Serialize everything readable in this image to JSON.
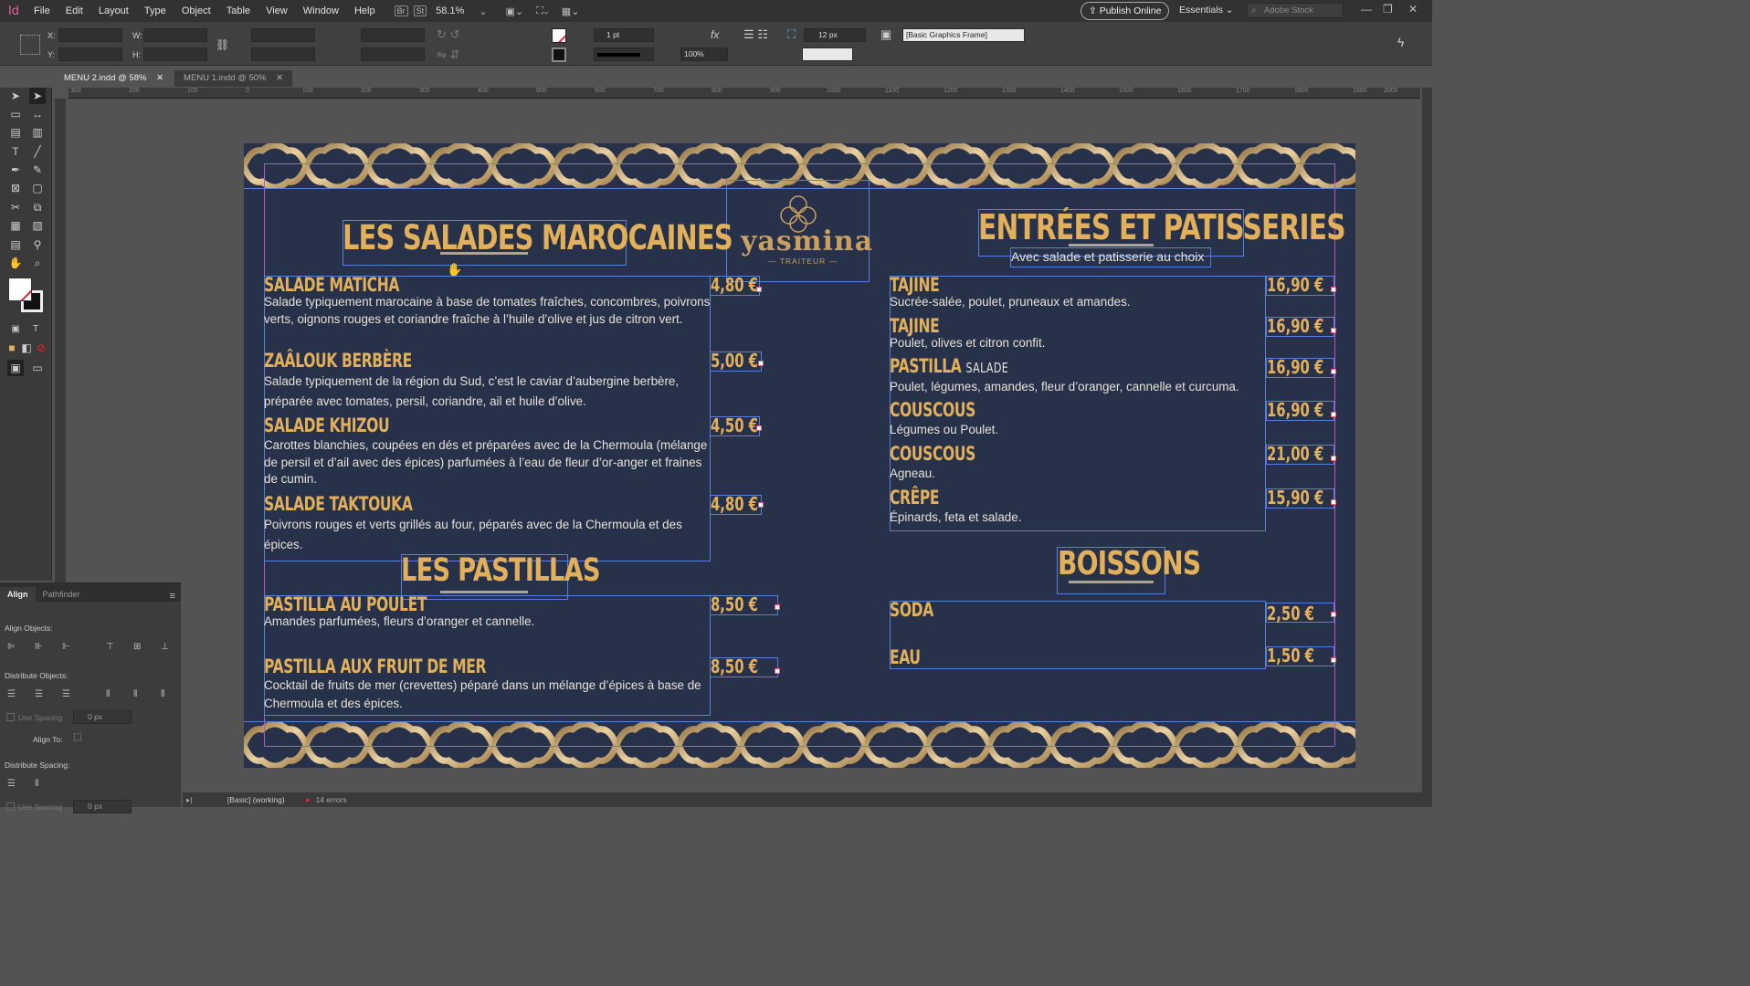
{
  "app": {
    "logo": "Id",
    "menu": [
      "File",
      "Edit",
      "Layout",
      "Type",
      "Object",
      "Table",
      "View",
      "Window",
      "Help"
    ],
    "bridge": "Br",
    "stock_btn": "St",
    "zoom": "58.1%",
    "publish": "Publish Online",
    "workspace": "Essentials",
    "search_placeholder": "Adobe Stock"
  },
  "control": {
    "x_label": "X:",
    "y_label": "Y:",
    "w_label": "W:",
    "h_label": "H:",
    "stroke_weight": "1 pt",
    "scale": "100%",
    "gap": "12 px",
    "frame_style": "[Basic Graphics Frame]"
  },
  "tabs": [
    {
      "label": "MENU 2.indd @ 58%"
    },
    {
      "label": "MENU 1.indd @ 50%"
    }
  ],
  "ruler": [
    "300",
    "200",
    "100",
    "0",
    "100",
    "200",
    "300",
    "400",
    "500",
    "600",
    "700",
    "800",
    "900",
    "1000",
    "1100",
    "1200",
    "1300",
    "1400",
    "1500",
    "1600",
    "1700",
    "1800",
    "1900",
    "2000"
  ],
  "align_panel": {
    "tab_align": "Align",
    "tab_pathfinder": "Pathfinder",
    "align_objects": "Align Objects:",
    "distribute_objects": "Distribute Objects:",
    "use_spacing": "Use Spacing",
    "spacing_value": "0 px",
    "align_to": "Align To:",
    "distribute_spacing": "Distribute Spacing:",
    "use_spacing_2": "Use Spacing",
    "spacing_value_2": "0 px"
  },
  "status": {
    "preflight_profile": "[Basic] (working)",
    "errors": "14 errors"
  },
  "menu_doc": {
    "brand": "yasmina",
    "brand_sub": "TRAITEUR",
    "left": {
      "title": "LES SALADES MAROCAINES",
      "items": [
        {
          "name": "SALADE MATICHA",
          "price": "4,80 €",
          "desc": "Salade typiquement marocaine à base de tomates fraîches, concombres, poivrons verts, oignons rouges et coriandre fraîche à l’huile d’olive et jus de citron vert."
        },
        {
          "name": "ZAÂLOUK BERBÈRE",
          "price": "5,00 €",
          "desc": "Salade typiquement de la région du Sud, c’est le caviar d’aubergine berbère, préparée avec tomates, persil, coriandre, ail et huile d’olive."
        },
        {
          "name": "SALADE KHIZOU",
          "price": "4,50 €",
          "desc": "Carottes blanchies, coupées en dés et préparées avec de la Chermoula (mélange de persil et d’ail avec des épices) parfumées à l’eau de fleur d’or-anger et fraines de cumin."
        },
        {
          "name": "SALADE TAKTOUKA",
          "price": "4,80 €",
          "desc": "Poivrons rouges et verts grillés au four, péparés avec de la Chermoula et des épices."
        }
      ]
    },
    "pastillas": {
      "title": "LES PASTILLAS",
      "items": [
        {
          "name": "PASTILLA AU POULET",
          "price": "8,50 €",
          "desc": "Amandes parfumées, fleurs d’oranger et cannelle."
        },
        {
          "name": "PASTILLA AUX FRUIT DE MER",
          "price": "8,50 €",
          "desc": "Cocktail de fruits de mer (crevettes) péparé dans un mélange d’épices à base de Chermoula et des épices."
        }
      ]
    },
    "right": {
      "title": "ENTRÉES ET PATISSERIES",
      "subtitle": "Avec salade et patisserie au choix",
      "items": [
        {
          "name": "TAJINE",
          "extra": "",
          "price": "16,90 €",
          "desc": "Sucrée-salée, poulet, pruneaux et amandes."
        },
        {
          "name": "TAJINE",
          "extra": "",
          "price": "16,90 €",
          "desc": "Poulet, olives et citron confit."
        },
        {
          "name": "PASTILLA",
          "extra": "SALADE",
          "price": "16,90 €",
          "desc": "Poulet, légumes, amandes, fleur d’oranger, cannelle et curcuma."
        },
        {
          "name": "COUSCOUS",
          "extra": "",
          "price": "16,90 €",
          "desc": "Légumes ou Poulet."
        },
        {
          "name": "COUSCOUS",
          "extra": "",
          "price": "21,00 €",
          "desc": "Agneau."
        },
        {
          "name": "CRÊPE",
          "extra": "",
          "price": "15,90 €",
          "desc": "Épinards, feta et salade."
        }
      ]
    },
    "drinks": {
      "title": "BOISSONS",
      "items": [
        {
          "name": "SODA",
          "price": "2,50 €"
        },
        {
          "name": "EAU",
          "price": "1,50 €"
        }
      ]
    }
  }
}
